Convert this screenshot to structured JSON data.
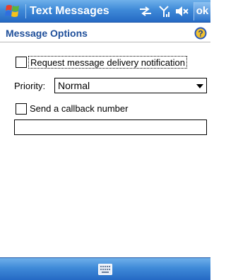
{
  "titlebar": {
    "app_title": "Text Messages",
    "ok_label": "ok",
    "icons": [
      "start-flag-icon",
      "connectivity-icon",
      "signal-icon",
      "speaker-muted-icon"
    ]
  },
  "page": {
    "title": "Message Options",
    "help_icon": "help-icon"
  },
  "form": {
    "delivery_notification": {
      "label": "Request message delivery notification",
      "checked": false
    },
    "priority": {
      "label": "Priority:",
      "value": "Normal"
    },
    "callback": {
      "label": "Send a callback number",
      "checked": false,
      "value": ""
    }
  },
  "bottombar": {
    "icons": [
      "keyboard-icon"
    ]
  },
  "colors": {
    "bar_blue": "#3f8ad8",
    "title_text": "#1f4f9a",
    "help_blue": "#2a58b8"
  }
}
